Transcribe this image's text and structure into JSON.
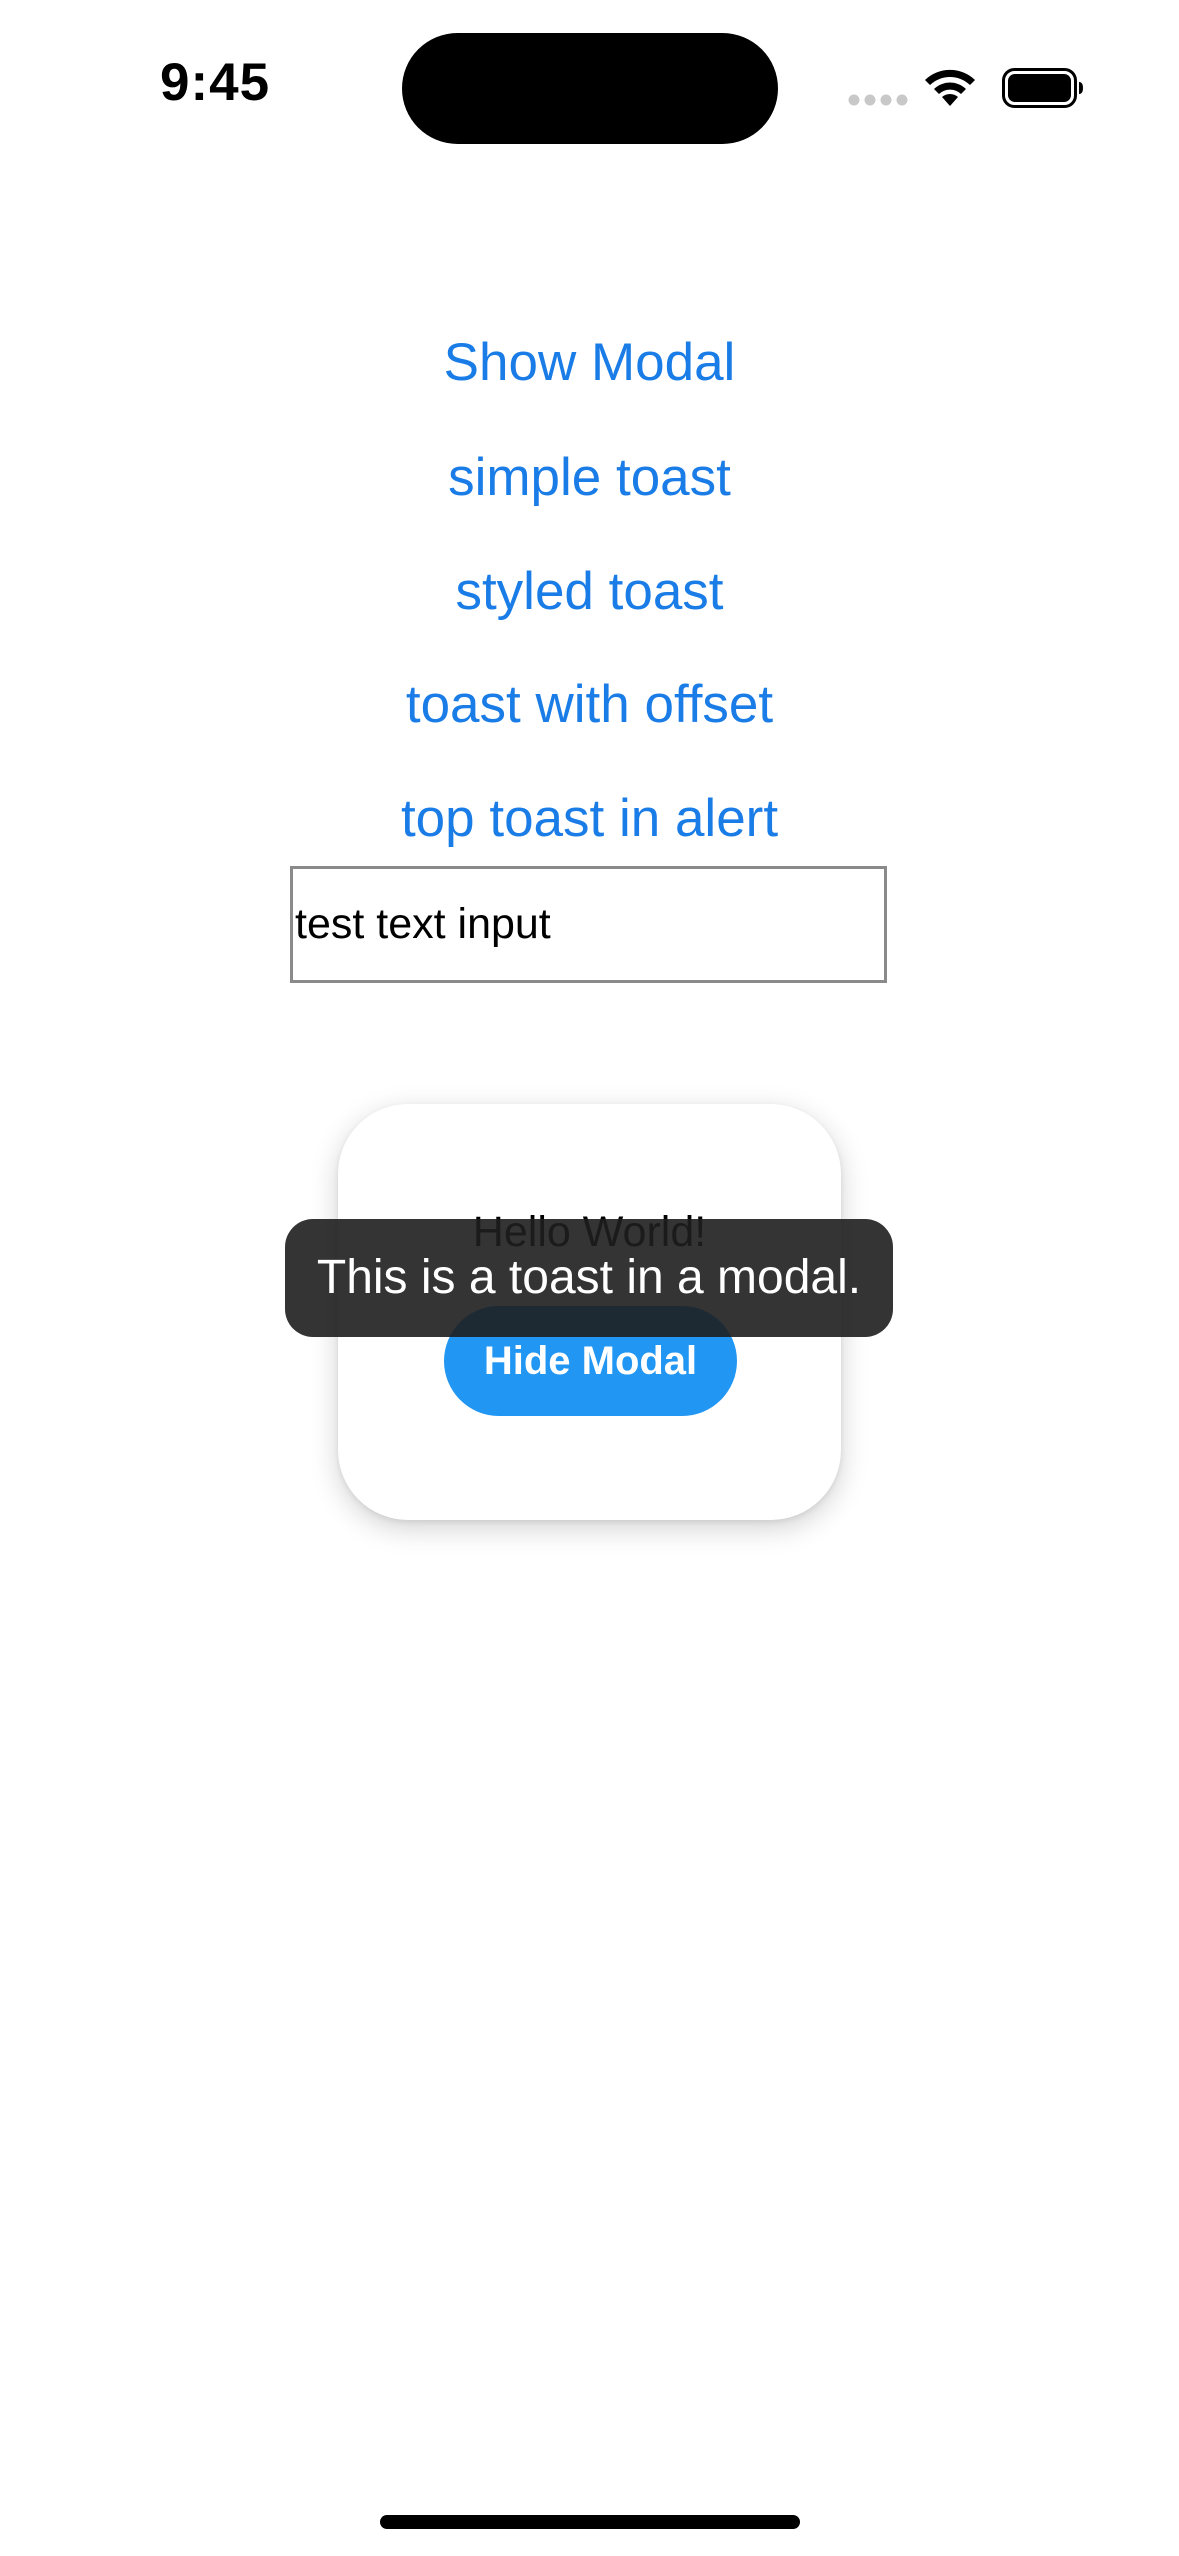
{
  "status_bar": {
    "time": "9:45"
  },
  "menu": {
    "show_modal": "Show Modal",
    "simple_toast": "simple toast",
    "styled_toast": "styled toast",
    "toast_with_offset": "toast with offset",
    "top_toast_in_alert": "top toast in alert"
  },
  "text_input": {
    "value": "test text input"
  },
  "modal": {
    "message": "Hello World!",
    "hide_button_label": "Hide Modal"
  },
  "toast": {
    "message": "This is a toast in a modal."
  },
  "colors": {
    "link": "#1a7ce6",
    "primary_button": "#2196f3",
    "toast_background": "#1e1e1e"
  },
  "icons": {
    "signal": "cellular-signal-icon",
    "wifi": "wifi-icon",
    "battery": "battery-icon"
  }
}
